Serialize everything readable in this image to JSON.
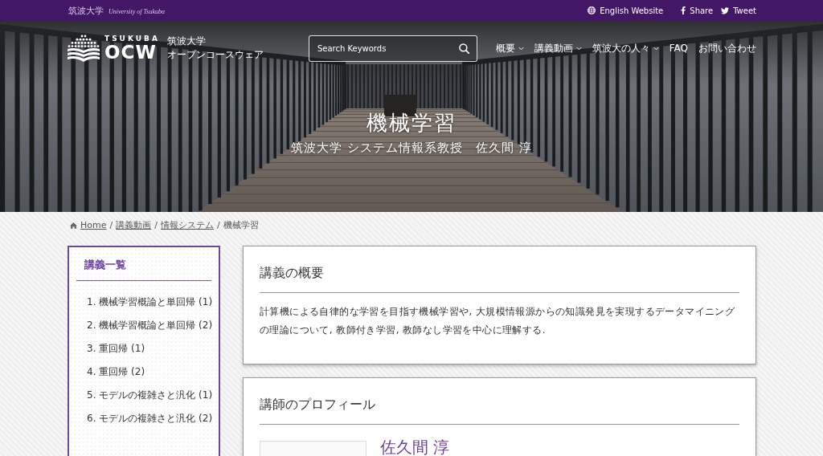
{
  "top_bar": {
    "university_name": "筑波大学",
    "university_name_en": "University of Tsukuba",
    "links": [
      {
        "label": "English Website",
        "kind": "globe"
      },
      {
        "label": "Share",
        "kind": "facebook"
      },
      {
        "label": "Tweet",
        "kind": "twitter"
      }
    ]
  },
  "header": {
    "logo": {
      "wordmark_top": "TSUKUBA",
      "wordmark": "OCW",
      "title": "筑波大学",
      "subtitle": "オープンコースウェア"
    },
    "search": {
      "placeholder": "Search Keywords"
    },
    "nav": [
      {
        "label": "概要",
        "dropdown": true
      },
      {
        "label": "講義動画",
        "dropdown": true
      },
      {
        "label": "筑波大の人々",
        "dropdown": true
      },
      {
        "label": "FAQ",
        "dropdown": false
      },
      {
        "label": "お問い合わせ",
        "dropdown": false
      }
    ]
  },
  "hero": {
    "title": "機械学習",
    "subtitle": "筑波大学 システム情報系教授　佐久間 淳"
  },
  "breadcrumb": [
    {
      "label": "Home",
      "kind": "home"
    },
    {
      "label": "講義動画",
      "kind": "link",
      "separator": "/"
    },
    {
      "label": "情報システム",
      "kind": "link",
      "separator": "/"
    },
    {
      "label": "機械学習",
      "kind": "current",
      "separator": "/"
    }
  ],
  "sidebar": {
    "title": "講義一覧",
    "lectures": [
      "1. 機械学習概論と単回帰 (1)",
      "2. 機械学習概論と単回帰 (2)",
      "3. 重回帰 (1)",
      "4. 重回帰 (2)",
      "5. モデルの複雑さと汎化 (1)",
      "6. モデルの複雑さと汎化 (2)"
    ]
  },
  "overview": {
    "title": "講義の概要",
    "text": "計算機による自律的な学習を目指す機械学習や, 大規模情報源からの知識発見を実現するデータマイニングの理論について, 教師付き学習, 教師なし学習を中心に理解する."
  },
  "profile": {
    "title": "講師のプロフィール",
    "name": "佐久間 淳"
  }
}
